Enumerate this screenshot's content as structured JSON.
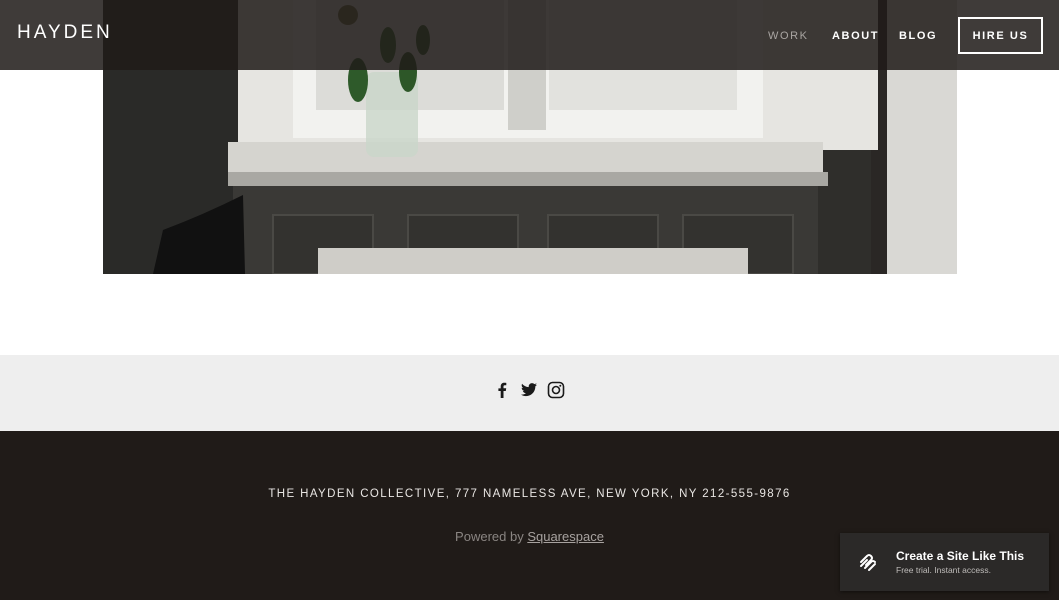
{
  "header": {
    "logo": "HAYDEN",
    "nav": [
      "WORK",
      "ABOUT",
      "BLOG"
    ],
    "cta": "HIRE US"
  },
  "social": {
    "icons": [
      "facebook-icon",
      "twitter-icon",
      "instagram-icon"
    ]
  },
  "footer": {
    "address": "THE HAYDEN COLLECTIVE, 777 NAMELESS AVE, NEW YORK, NY   212-555-9876",
    "powered_prefix": "Powered by ",
    "powered_link": "Squarespace"
  },
  "badge": {
    "title": "Create a Site Like This",
    "subtitle": "Free trial. Instant access."
  },
  "colors": {
    "header_bg": "#201b19",
    "footer_bg": "#201b18",
    "social_bg": "#eeeeee",
    "nav_active": "#a9a5a2"
  }
}
